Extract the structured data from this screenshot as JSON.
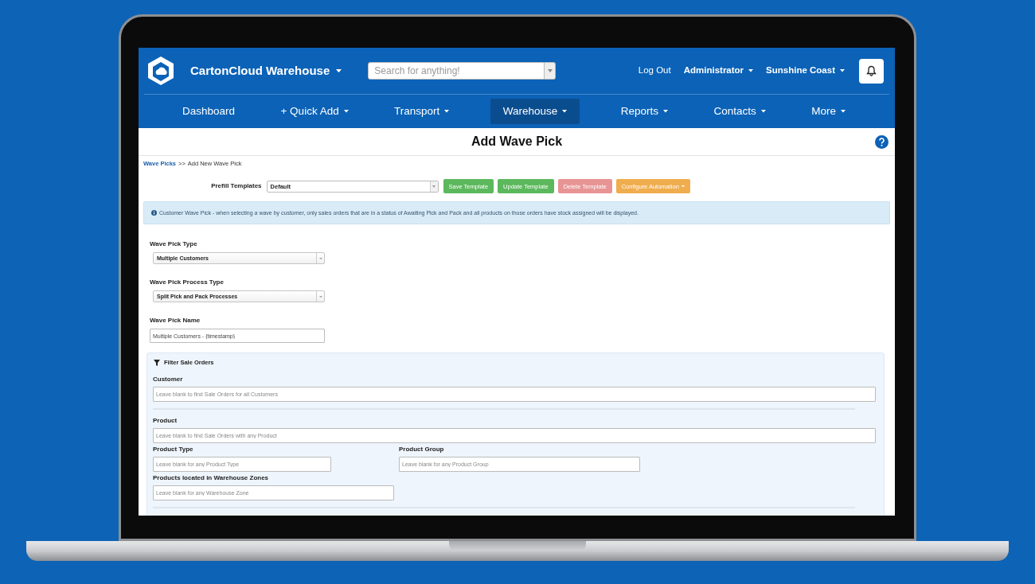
{
  "header": {
    "app_title": "CartonCloud Warehouse",
    "search": {
      "placeholder": "Search for anything!"
    },
    "links": [
      {
        "label": "Log Out",
        "dropdown": false
      },
      {
        "label": "Administrator",
        "dropdown": true
      },
      {
        "label": "Sunshine Coast",
        "dropdown": true
      }
    ]
  },
  "nav": {
    "items": [
      {
        "label": "Dashboard",
        "dropdown": false,
        "selected": false
      },
      {
        "label": "+ Quick Add",
        "dropdown": true,
        "selected": false
      },
      {
        "label": "Transport",
        "dropdown": true,
        "selected": false
      },
      {
        "label": "Warehouse",
        "dropdown": true,
        "selected": true
      },
      {
        "label": "Reports",
        "dropdown": true,
        "selected": false
      },
      {
        "label": "Contacts",
        "dropdown": true,
        "selected": false
      },
      {
        "label": "More",
        "dropdown": true,
        "selected": false
      }
    ]
  },
  "page_title": "Add Wave Pick",
  "breadcrumb": {
    "link": "Wave Picks",
    "separator": ">>",
    "current": "Add New Wave Pick"
  },
  "prefill": {
    "label": "Prefill Templates",
    "value": "Default",
    "buttons": [
      {
        "label": "Save Template",
        "kind": "success",
        "dropdown": false
      },
      {
        "label": "Update Template",
        "kind": "success",
        "dropdown": false
      },
      {
        "label": "Delete Template",
        "kind": "danger",
        "dropdown": false
      },
      {
        "label": "Configure Automation",
        "kind": "warning",
        "dropdown": true
      }
    ]
  },
  "notice": "Customer Wave Pick - when selecting a wave by customer, only sales orders that are in a status of Awaiting Pick and Pack and all products on those orders have stock assigned will be displayed.",
  "form": [
    {
      "label": "Wave Pick Type",
      "kind": "select",
      "value": "Multiple Customers"
    },
    {
      "label": "Wave Pick Process Type",
      "kind": "select",
      "value": "Split Pick and Pack Processes"
    },
    {
      "label": "Wave Pick Name",
      "kind": "text",
      "value": "Multiple Customers - {timestamp}"
    }
  ],
  "filter": {
    "title": "Filter Sale Orders",
    "rows": [
      {
        "fields": [
          {
            "label": "Customer",
            "placeholder": "Leave blank to find Sale Orders for all Customers",
            "kind": "wide"
          }
        ],
        "divider": true
      },
      {
        "fields": [
          {
            "label": "Product",
            "placeholder": "Leave blank to find Sale Orders with any Product",
            "kind": "wide"
          }
        ],
        "divider": false
      },
      {
        "fields": [
          {
            "label": "Product Type",
            "placeholder": "Leave blank for any Product Type",
            "kind": "short"
          },
          {
            "label": "Product Group",
            "placeholder": "Leave blank for any Product Group",
            "kind": "medium"
          }
        ],
        "divider": false
      },
      {
        "fields": [
          {
            "label": "Products located in Warehouse Zones",
            "placeholder": "Leave blank for any Warehouse Zone",
            "kind": "medium"
          }
        ],
        "divider": true
      }
    ]
  }
}
